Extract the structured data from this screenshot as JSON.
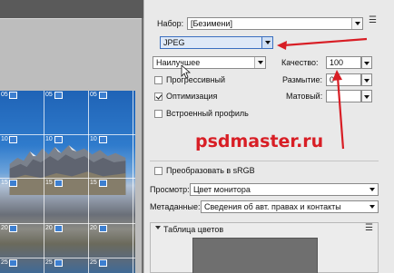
{
  "preset": {
    "label": "Набор:",
    "value": "[Безимени]"
  },
  "format": {
    "value": "JPEG"
  },
  "quality_preset": {
    "value": "Наилучшее"
  },
  "quality": {
    "label": "Качество:",
    "value": "100"
  },
  "blur": {
    "label": "Размытие:",
    "value": "0"
  },
  "matte": {
    "label": "Матовый:"
  },
  "checkboxes": {
    "progressive": {
      "label": "Прогрессивный",
      "checked": false
    },
    "optimized": {
      "label": "Оптимизация",
      "checked": true
    },
    "embed_profile": {
      "label": "Встроенный профиль",
      "checked": false
    },
    "srgb": {
      "label": "Преобразовать в sRGB",
      "checked": false
    }
  },
  "preview": {
    "label": "Просмотр:",
    "value": "Цвет монитора"
  },
  "metadata": {
    "label": "Метаданные:",
    "value": "Сведения об авт. правах и контакты"
  },
  "color_table": {
    "title": "Таблица цветов"
  },
  "watermark": "psdmaster.ru",
  "colors": {
    "annotation_red": "#d81e25",
    "slice_blue": "#3d7fd0"
  },
  "slices": {
    "labels": [
      "05",
      "10",
      "15",
      "20",
      "25"
    ]
  }
}
